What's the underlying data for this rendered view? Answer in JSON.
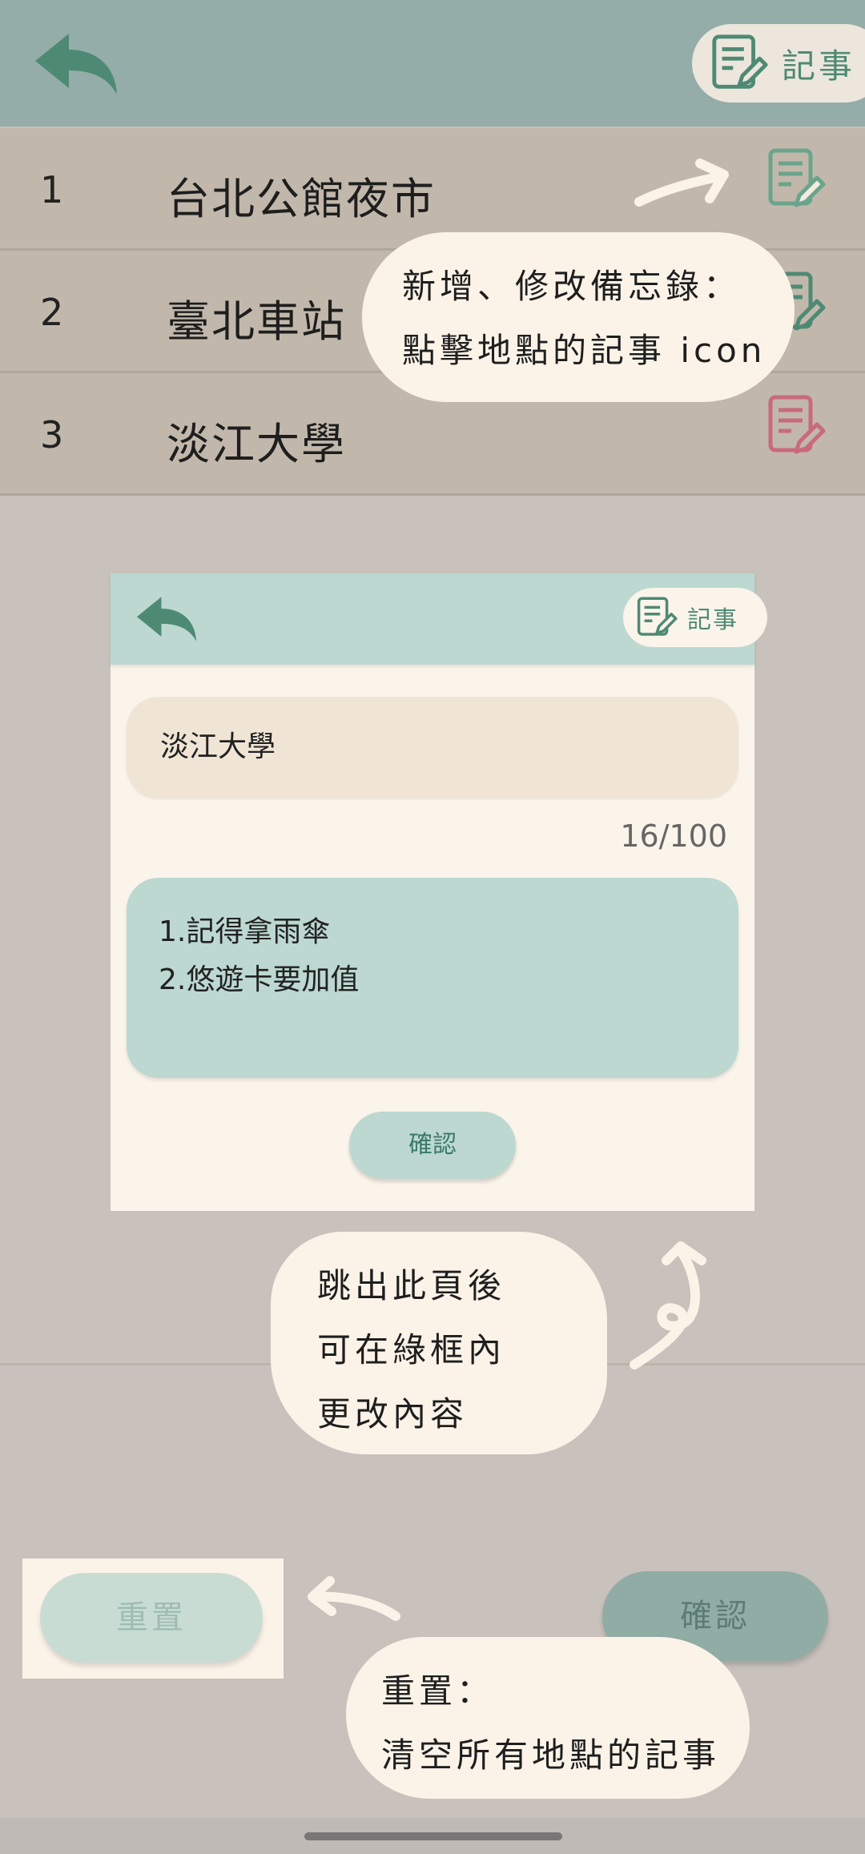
{
  "header": {
    "notes_tab_label": "記事",
    "back_icon": "back-arrow-icon",
    "notes_icon": "note-edit-icon"
  },
  "locations": [
    {
      "num": "1",
      "name": "台北公館夜市",
      "icon_color": "#6aa48c"
    },
    {
      "num": "2",
      "name": "臺北車站",
      "icon_color": "#4e8a73"
    },
    {
      "num": "3",
      "name": "淡江大學",
      "icon_color": "#c96a7a"
    }
  ],
  "annotations": {
    "edit_memo": {
      "line1": "新增、修改備忘錄：",
      "line2": "點擊地點的記事 icon"
    },
    "after_leave": {
      "line1": "跳出此頁後",
      "line2": "可在綠框內",
      "line3": "更改內容"
    },
    "reset": {
      "line1": "重置：",
      "line2": "清空所有地點的記事"
    }
  },
  "memo_card": {
    "notes_tab_label": "記事",
    "title": "淡江大學",
    "counter": "16/100",
    "content": "1.記得拿雨傘\n2.悠遊卡要加值",
    "confirm_label": "確認"
  },
  "bottom": {
    "reset_label": "重置",
    "confirm_label": "確認"
  },
  "colors": {
    "header": "#95ada8",
    "row": "#c1b8ab",
    "card_accent": "#bcd8d1",
    "bubble": "#fbf3e8"
  }
}
